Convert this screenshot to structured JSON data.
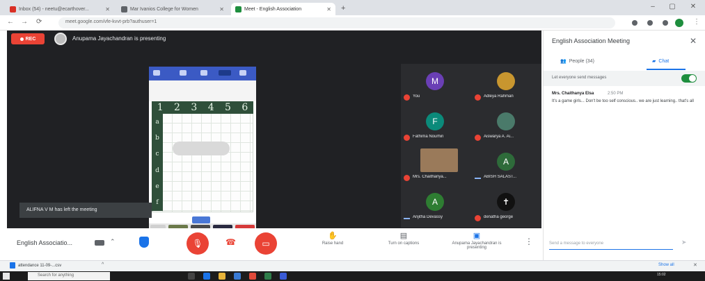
{
  "browser": {
    "tabs": [
      {
        "title": "Inbox (54) - neetu@ecarthover...",
        "favicon_color": "#d93025",
        "active": false
      },
      {
        "title": "Mar Ivanios College for Women",
        "favicon_color": "#5f6368",
        "active": false
      },
      {
        "title": "Meet - English Association",
        "favicon_color": "#1e8e3e",
        "active": true
      }
    ],
    "new_tab_label": "+",
    "window_controls": [
      "–",
      "▢",
      "✕"
    ],
    "nav": {
      "back": "←",
      "forward": "→",
      "reload": "⟳"
    },
    "url": "meet.google.com/vfe-kvvt-prb?authuser=1"
  },
  "stage": {
    "rec_label": "REC",
    "presenting_text": "Anupama Jayachandran is presenting",
    "shared_screen": {
      "columns": [
        "1",
        "2",
        "3",
        "4",
        "5",
        "6"
      ],
      "rows": [
        "a",
        "b",
        "c",
        "d",
        "e",
        "f"
      ]
    },
    "toast": "ALIFNA V M has left the meeting"
  },
  "participants": [
    {
      "name": "You",
      "initial": "M",
      "color": "#6a3fb5",
      "muted": true
    },
    {
      "name": "Adleya Rahman",
      "initial": "",
      "color": "#c8962f",
      "muted": true
    },
    {
      "name": "Fathima Nourhin",
      "initial": "F",
      "color": "#0b8a7a",
      "muted": true
    },
    {
      "name": "Aiswarya A. Ai...",
      "initial": "",
      "color": "#4a7a6a",
      "muted": true
    },
    {
      "name": "Mrs. Chaithanya...",
      "initial": "",
      "color": "#9a7a5a",
      "muted": true
    },
    {
      "name": "ABISH SALAST...",
      "initial": "A",
      "color": "#2e6b3a",
      "muted": false
    },
    {
      "name": "Anjitha Devassy",
      "initial": "A",
      "color": "#2e7d32",
      "muted": false
    },
    {
      "name": "denatha george",
      "initial": "✝",
      "color": "#111111",
      "muted": true
    }
  ],
  "bottom_bar": {
    "meeting_name": "English Associatio...",
    "actions": [
      {
        "icon": "✋",
        "label": "Raise hand"
      },
      {
        "icon": "▤",
        "label": "Turn on captions"
      },
      {
        "icon": "▣",
        "label": "Anupama Jayachandran is presenting"
      }
    ],
    "more": "⋮"
  },
  "panel": {
    "title": "English Association Meeting",
    "close": "✕",
    "tab_people": "People (34)",
    "tab_chat": "Chat",
    "toggle_label": "Let everyone send messages",
    "message": {
      "sender": "Mrs. Chaithanya Elsa",
      "time": "2:50 PM",
      "text": "It's a game girls... Don't be too self conscious.. we are just learning.. that's all"
    },
    "input_placeholder": "Send a message to everyone",
    "send": "➤"
  },
  "downloads": {
    "item": "attendance 11-09-...csv",
    "chevron": "^",
    "show_all": "Show all",
    "close": "✕"
  },
  "taskbar": {
    "search_placeholder": "Search for anything",
    "clock": "15:02"
  },
  "colors": {
    "meet_dark": "#202124",
    "accent": "#1a73e8",
    "danger": "#ea4335",
    "success": "#1e8e3e"
  }
}
